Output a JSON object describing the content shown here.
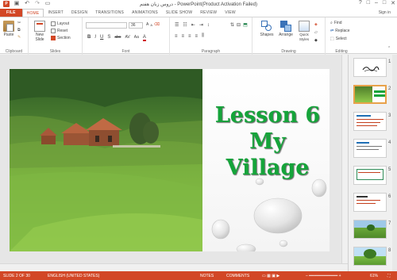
{
  "window": {
    "title": "دروس زبان هفتم - PowerPoint(Product Activation Failed)",
    "controls": [
      "?",
      "□",
      "–",
      "□",
      "✕"
    ]
  },
  "tabs": [
    {
      "label": "FILE"
    },
    {
      "label": "HOME"
    },
    {
      "label": "INSERT"
    },
    {
      "label": "DESIGN"
    },
    {
      "label": "TRANSITIONS"
    },
    {
      "label": "ANIMATIONS"
    },
    {
      "label": "SLIDE SHOW"
    },
    {
      "label": "REVIEW"
    },
    {
      "label": "VIEW"
    }
  ],
  "signin": "Sign in",
  "ribbon": {
    "clipboard": {
      "label": "Clipboard",
      "paste": "Paste"
    },
    "slides": {
      "label": "Slides",
      "new_slide": "New Slide",
      "layout": "Layout",
      "reset": "Reset",
      "section": "Section"
    },
    "font": {
      "label": "Font",
      "name": "",
      "size": "36",
      "buttons": [
        "B",
        "I",
        "U",
        "S",
        "abc",
        "AV",
        "Aa",
        "A"
      ]
    },
    "paragraph": {
      "label": "Paragraph"
    },
    "drawing": {
      "label": "Drawing",
      "shapes": "Shapes",
      "arrange": "Arrange",
      "quick_styles": "Quick Styles"
    },
    "editing": {
      "label": "Editing",
      "find": "Find",
      "replace": "Replace",
      "select": "Select"
    }
  },
  "slide": {
    "title_line1": "Lesson 6",
    "title_line2": "My Village",
    "title_color": "#15a43a"
  },
  "thumbnails": [
    {
      "num": "1"
    },
    {
      "num": "2"
    },
    {
      "num": "3"
    },
    {
      "num": "4"
    },
    {
      "num": "5"
    },
    {
      "num": "6"
    },
    {
      "num": "7"
    },
    {
      "num": "8"
    }
  ],
  "status": {
    "slide_info": "SLIDE 2 OF 30",
    "language": "ENGLISH (UNITED STATES)",
    "notes": "NOTES",
    "comments": "COMMENTS",
    "zoom": "61%"
  },
  "colors": {
    "accent": "#d24726"
  }
}
